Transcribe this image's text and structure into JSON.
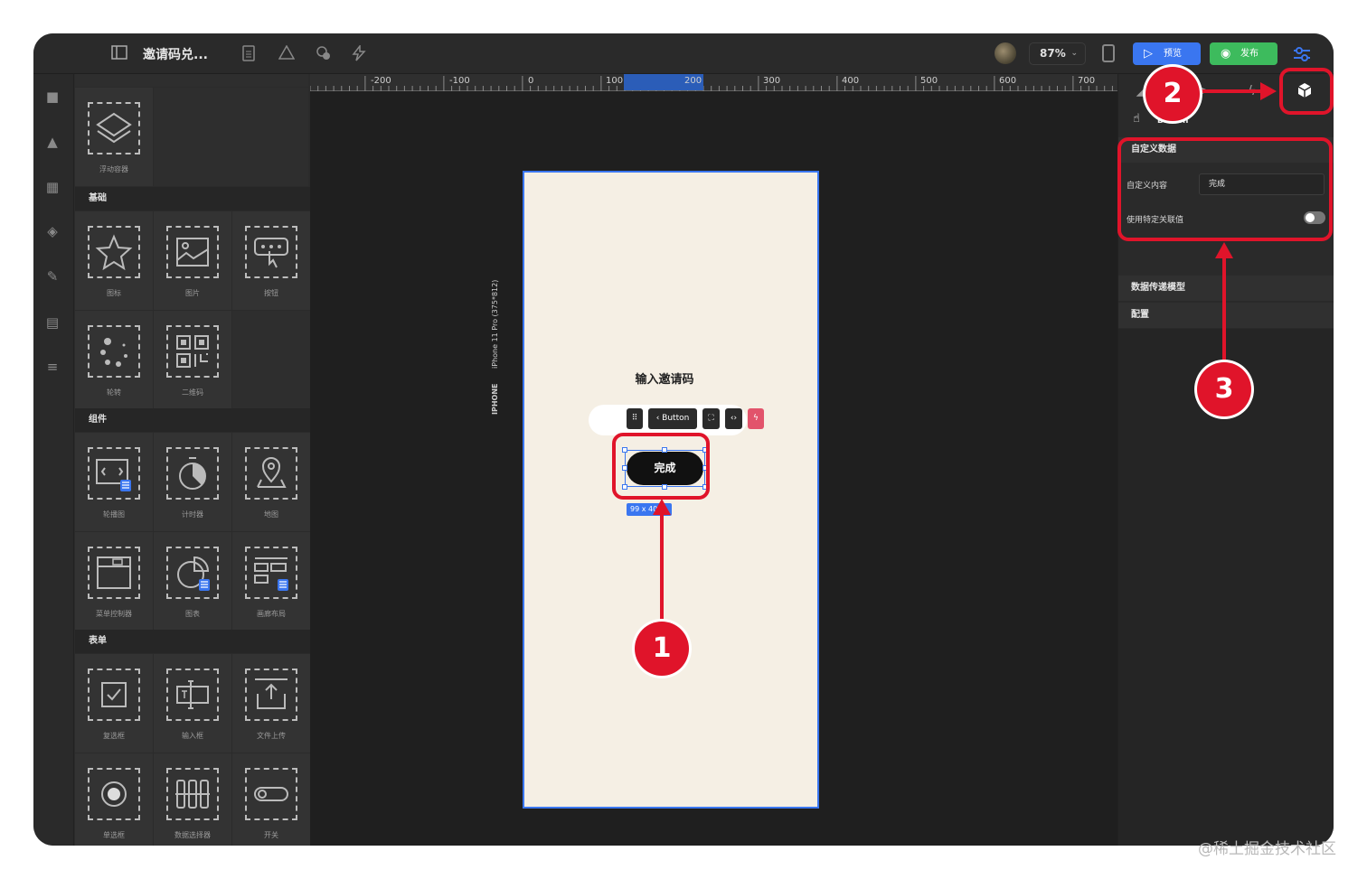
{
  "app": {
    "title": "邀请码兑...",
    "zoom": "87%",
    "preview_label": "预览",
    "publish_label": "发布",
    "accent": "#3a76f0",
    "publish_color": "#3dbb5d"
  },
  "panel": {
    "sections": {
      "basic": "基础",
      "components": "组件",
      "forms": "表单"
    },
    "items": {
      "floating_container": "浮动容器",
      "icon": "图标",
      "image": "图片",
      "button": "按钮",
      "carousel": "轮转",
      "qrcode": "二维码",
      "slideshow": "轮播图",
      "timer": "计时器",
      "map": "地图",
      "menu_controller": "菜单控制器",
      "chart": "图表",
      "gallery_layout": "画廊布局",
      "checkbox": "复选框",
      "input": "输入框",
      "file_upload": "文件上传",
      "radio": "单选框",
      "data_picker": "数据选择器",
      "switch": "开关"
    }
  },
  "ruler": {
    "ticks": [
      "-200",
      "-100",
      "0",
      "100",
      "200",
      "300",
      "400",
      "500",
      "600",
      "700"
    ]
  },
  "canvas": {
    "device_name": "IPHONE",
    "device_model": "iPhone 11 Pro (375*812)",
    "page_title": "输入邀请码",
    "toolbar_component": "Button",
    "selected_button_text": "完成",
    "size_badge": "99 x 40",
    "background": "#f5efe4"
  },
  "right_panel": {
    "selected_component": "Button",
    "custom_data_section": "自定义数据",
    "custom_content_label": "自定义内容",
    "custom_content_value": "完成",
    "use_specific_value_label": "使用特定关联值",
    "use_specific_value_on": false,
    "data_model_section": "数据传递模型",
    "config_section": "配置"
  },
  "annotations": {
    "step1": "1",
    "step2": "2",
    "step3": "3",
    "color": "#e0142a"
  },
  "watermark": "@稀土掘金技术社区"
}
